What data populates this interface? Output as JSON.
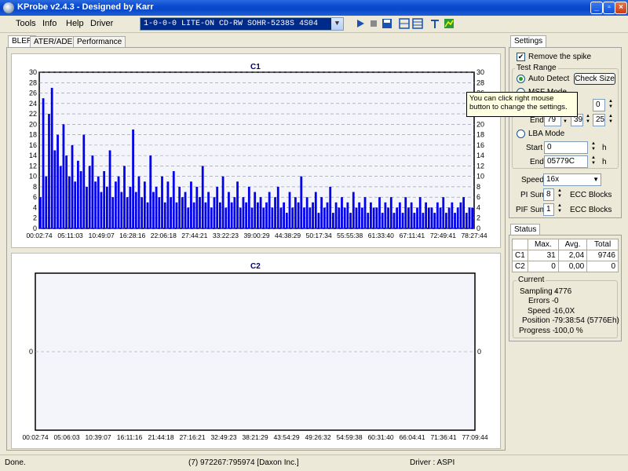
{
  "window": {
    "title": "KProbe v2.4.3 - Designed by Karr"
  },
  "menu": [
    "Tools",
    "Info",
    "Help",
    "Driver"
  ],
  "drive": {
    "selected": "1-0-0-0 LITE-ON CD-RW SOHR-5238S 4S04"
  },
  "tabs": [
    "BLER",
    "ATER/ADER",
    "Performance"
  ],
  "chart_data": [
    {
      "type": "bar",
      "title": "C1",
      "ylim": [
        0,
        30
      ],
      "yticks": [
        0,
        2,
        4,
        6,
        8,
        10,
        12,
        14,
        16,
        18,
        20,
        22,
        24,
        26,
        28,
        30
      ],
      "xticks": [
        "00:02:74",
        "05:11:03",
        "10:49:07",
        "16:28:16",
        "22:06:18",
        "27:44:21",
        "33:22:23",
        "39:00:29",
        "44:38:29",
        "50:17:34",
        "55:55:38",
        "61:33:40",
        "67:11:41",
        "72:49:41",
        "78:27:44"
      ],
      "grid": true,
      "series": [
        {
          "values": [
            6,
            25,
            10,
            22,
            27,
            15,
            18,
            12,
            20,
            14,
            10,
            16,
            9,
            13,
            11,
            18,
            8,
            12,
            14,
            9,
            10,
            7,
            11,
            8,
            15,
            6,
            9,
            10,
            7,
            12,
            6,
            8,
            19,
            7,
            10,
            6,
            9,
            5,
            14,
            7,
            8,
            6,
            10,
            5,
            9,
            6,
            11,
            5,
            8,
            6,
            7,
            4,
            9,
            5,
            8,
            6,
            12,
            5,
            7,
            4,
            6,
            8,
            5,
            10,
            4,
            7,
            5,
            6,
            9,
            4,
            6,
            5,
            8,
            4,
            7,
            5,
            6,
            4,
            5,
            7,
            4,
            6,
            8,
            4,
            5,
            3,
            7,
            4,
            6,
            5,
            10,
            4,
            6,
            4,
            5,
            7,
            3,
            6,
            4,
            5,
            8,
            3,
            5,
            4,
            6,
            4,
            5,
            3,
            7,
            4,
            5,
            4,
            6,
            3,
            5,
            4,
            4,
            6,
            3,
            5,
            4,
            6,
            3,
            4,
            5,
            3,
            6,
            4,
            5,
            3,
            4,
            6,
            3,
            5,
            4,
            4,
            3,
            5,
            4,
            6,
            3,
            4,
            5,
            3,
            4,
            5,
            6,
            3,
            4,
            4
          ]
        }
      ]
    },
    {
      "type": "bar",
      "title": "C2",
      "ylim": [
        0,
        1
      ],
      "yticks": [
        0
      ],
      "xticks": [
        "00:02:74",
        "05:06:03",
        "10:39:07",
        "16:11:16",
        "21:44:18",
        "27:16:21",
        "32:49:23",
        "38:21:29",
        "43:54:29",
        "49:26:32",
        "54:59:38",
        "60:31:40",
        "66:04:41",
        "71:36:41",
        "77:09:44"
      ],
      "grid": true,
      "series": [
        {
          "values": []
        }
      ]
    }
  ],
  "settings": {
    "tab": "Settings",
    "remove_spike": "Remove the spike",
    "test_range": "Test Range",
    "auto_detect": "Auto Detect",
    "check_size": "Check Size",
    "msf_mode": "MSF Mode",
    "msf_start_s": "0",
    "end_label": "End",
    "end_m": "79",
    "end_s": "39",
    "end_f": "25",
    "lba_mode": "LBA Mode",
    "start_label": "Start",
    "lba_start": "0",
    "lba_end": "05779C",
    "unit_h": "h",
    "speed_label": "Speed",
    "speed_value": "16x",
    "pi_sum_label": "PI Sum",
    "pi_sum_value": "8",
    "pif_sum_label": "PIF Sum",
    "pif_sum_value": "1",
    "ecc_blocks": "ECC Blocks"
  },
  "tooltip": "You can click right mouse button to change the settings.",
  "status": {
    "tab": "Status",
    "headers": [
      "",
      "Max.",
      "Avg.",
      "Total"
    ],
    "rows": [
      [
        "C1",
        "31",
        "2,04",
        "9746"
      ],
      [
        "C2",
        "0",
        "0,00",
        "0"
      ]
    ],
    "current": "Current",
    "sampling_label": "Sampling -",
    "sampling": "4776",
    "errors_label": "Errors -",
    "errors": "0",
    "speed_label": "Speed -",
    "speed": "16,0X",
    "position_label": "Position -",
    "position": "79:38:54 (5776Eh)",
    "progress_label": "Progress -",
    "progress": "100,0 %"
  },
  "statusbar": {
    "left": "Done.",
    "middle": "(7) 972267:795974 [Daxon Inc.]",
    "right": "Driver : ASPI"
  }
}
